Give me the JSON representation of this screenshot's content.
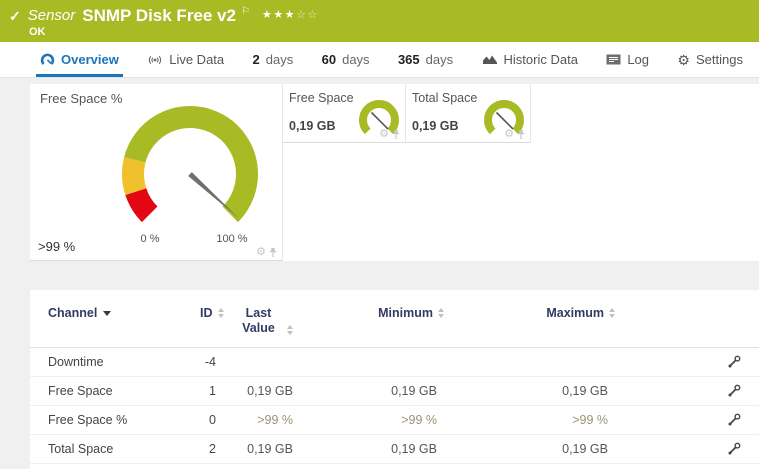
{
  "colors": {
    "green": "#a8bb24",
    "yellow": "#f0c12d",
    "red": "#e30613",
    "blue": "#1a75bb",
    "navy": "#333a63",
    "needle": "#6f6f6f",
    "page-bg": "#f0f0f0",
    "value-olive": "#9b9472"
  },
  "icons": {
    "check": "✓",
    "flag": "⚐",
    "stars_filled": "★★★",
    "stars_empty": "☆☆",
    "gear": "⚙"
  },
  "header": {
    "kind": "Sensor",
    "title": "SNMP Disk Free v2",
    "status": "OK",
    "rating_filled": 3,
    "rating_total": 5
  },
  "tabs": {
    "overview": {
      "label": "Overview"
    },
    "live": {
      "label": "Live Data"
    },
    "d2": {
      "num": "2",
      "unit": "days"
    },
    "d60": {
      "num": "60",
      "unit": "days"
    },
    "d365": {
      "num": "365",
      "unit": "days"
    },
    "historic": {
      "label": "Historic Data"
    },
    "log": {
      "label": "Log"
    },
    "settings": {
      "label": "Settings"
    }
  },
  "panels": {
    "free_space_pct": {
      "title": "Free Space %",
      "value": ">99 %",
      "value_percent": 99,
      "scale_min": "0 %",
      "scale_max": "100 %",
      "segments": [
        {
          "color": "red",
          "from": 0,
          "to": 10
        },
        {
          "color": "yellow",
          "from": 10,
          "to": 22
        },
        {
          "color": "green",
          "from": 22,
          "to": 100
        }
      ]
    },
    "free_space": {
      "title": "Free Space",
      "value": "0,19 GB"
    },
    "total_space": {
      "title": "Total Space",
      "value": "0,19 GB"
    }
  },
  "table": {
    "headers": {
      "channel": "Channel",
      "id": "ID",
      "last": "Last Value",
      "min": "Minimum",
      "max": "Maximum"
    },
    "rows": [
      {
        "channel": "Downtime",
        "id": "-4",
        "last": "",
        "min": "",
        "max": ""
      },
      {
        "channel": "Free Space",
        "id": "1",
        "last": "0,19 GB",
        "min": "0,19 GB",
        "max": "0,19 GB"
      },
      {
        "channel": "Free Space %",
        "id": "0",
        "last": ">99 %",
        "min": ">99 %",
        "max": ">99 %"
      },
      {
        "channel": "Total Space",
        "id": "2",
        "last": "0,19 GB",
        "min": "0,19 GB",
        "max": "0,19 GB"
      }
    ]
  }
}
